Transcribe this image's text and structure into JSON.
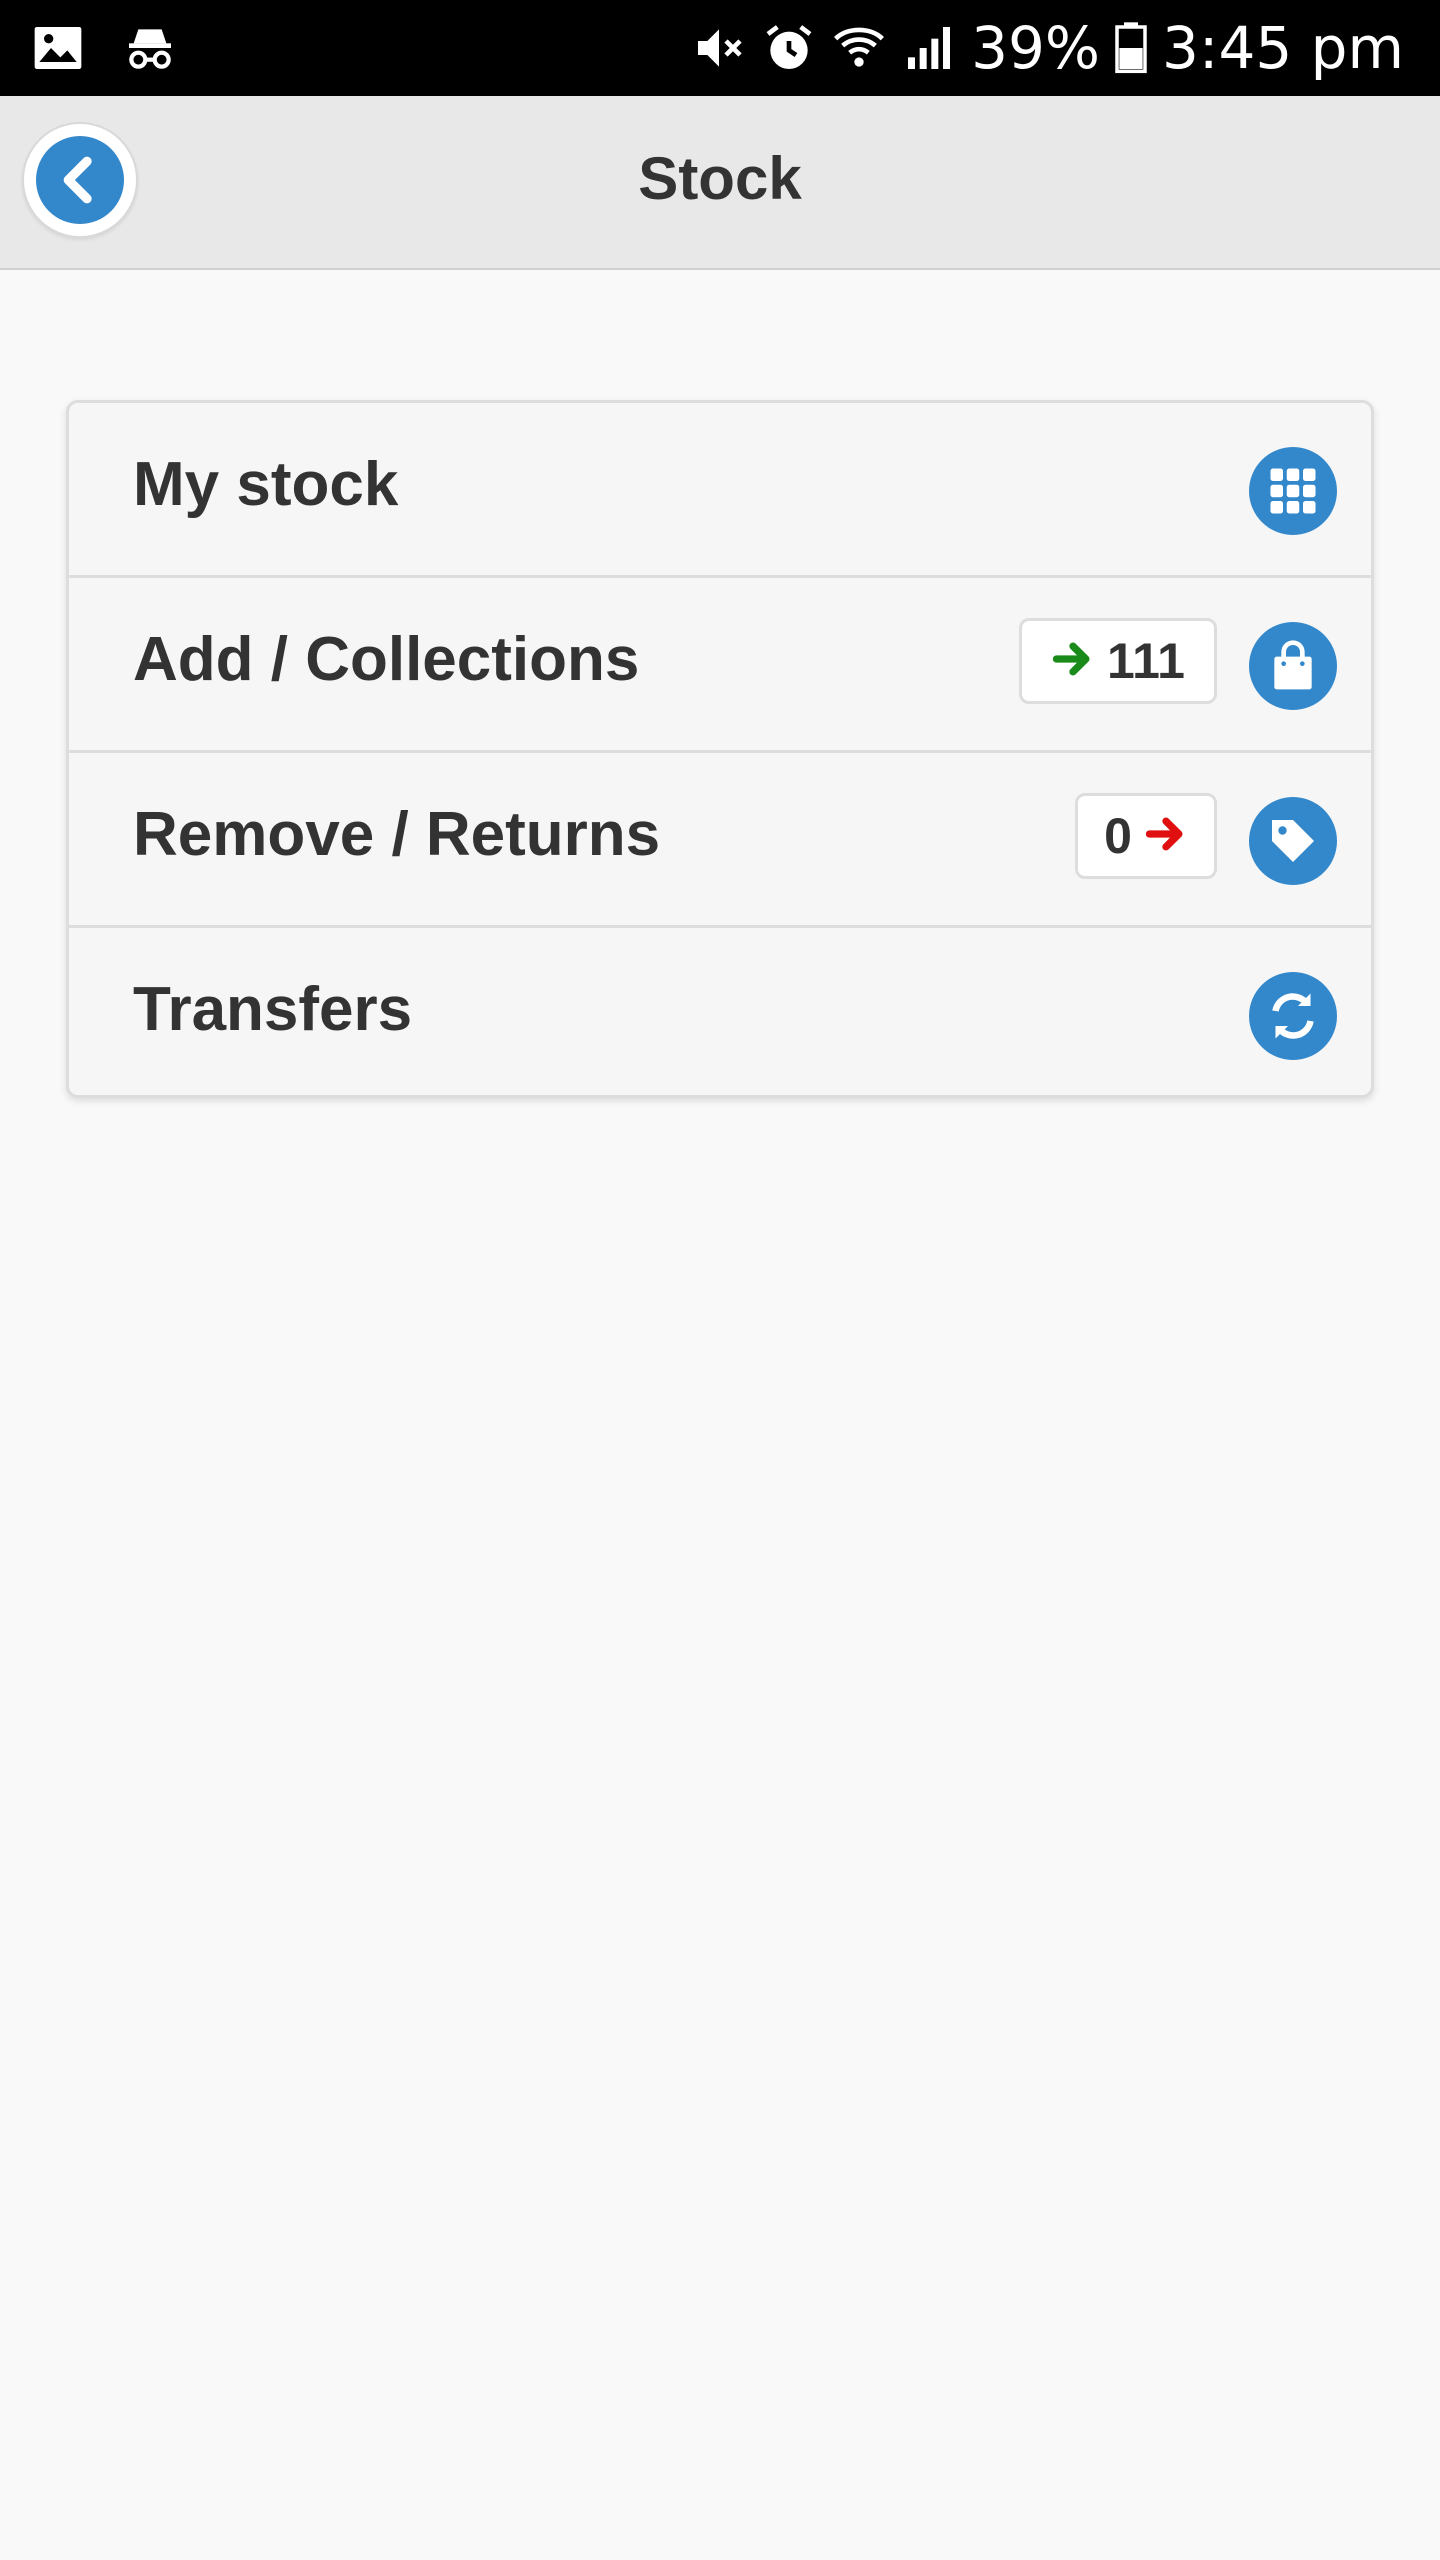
{
  "status_bar": {
    "battery": "39%",
    "time": "3:45 pm"
  },
  "header": {
    "title": "Stock"
  },
  "menu": {
    "items": [
      {
        "label": "My stock",
        "icon": "grid-icon"
      },
      {
        "label": "Add / Collections",
        "icon": "shopping-bag-icon",
        "badge": {
          "count": "111",
          "arrow": "right",
          "color": "#1a8a1a"
        }
      },
      {
        "label": "Remove / Returns",
        "icon": "tag-icon",
        "badge": {
          "count": "0",
          "arrow": "right",
          "color": "#e01010"
        }
      },
      {
        "label": "Transfers",
        "icon": "refresh-icon"
      }
    ]
  },
  "colors": {
    "accent": "#3388cc",
    "header_bg": "#e8e8e8",
    "page_bg": "#f9f9f9"
  }
}
